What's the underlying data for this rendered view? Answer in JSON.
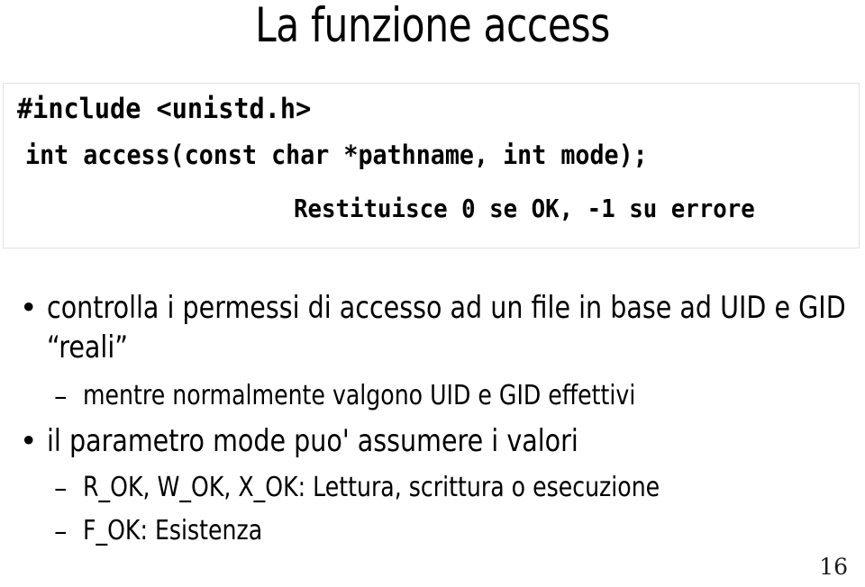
{
  "slide": {
    "title": "La funzione access",
    "page_number": "16",
    "code_box": {
      "border_color": "#e2e2e2",
      "lines": [
        "#include <unistd.h>",
        "int access(const char *pathname, int mode);",
        "Restituisce 0 se OK, -1 su errore"
      ]
    },
    "bullets": [
      {
        "level": 1,
        "marker": "•",
        "text": "controlla i permessi di accesso ad un file in base ad UID e GID “reali”"
      },
      {
        "level": 2,
        "marker": "–",
        "text": "mentre normalmente valgono UID e GID effettivi"
      },
      {
        "level": 1,
        "marker": "•",
        "text": "il parametro mode puo' assumere i valori"
      },
      {
        "level": 2,
        "marker": "–",
        "text": "R_OK, W_OK, X_OK: Lettura, scrittura o esecuzione"
      },
      {
        "level": 2,
        "marker": "–",
        "text": "F_OK: Esistenza"
      }
    ]
  }
}
